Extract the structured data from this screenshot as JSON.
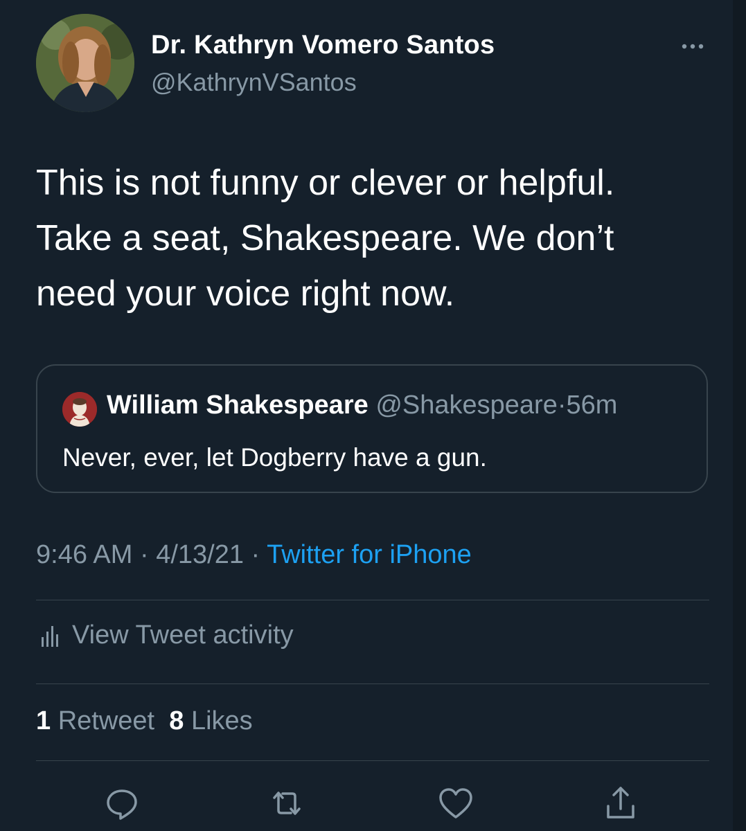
{
  "author": {
    "display_name": "Dr. Kathryn Vomero Santos",
    "handle": "@KathrynVSantos"
  },
  "tweet": {
    "lines": [
      "This is not funny or clever or helpful.",
      "Take a seat, Shakespeare. We don’t",
      "need your voice right now."
    ],
    "time": "9:46 AM",
    "date": "4/13/21",
    "source": "Twitter for iPhone",
    "separator": " · "
  },
  "quoted_tweet": {
    "name": "William Shakespeare",
    "handle": "@Shakespeare",
    "age": "56m",
    "dot": "·",
    "text": "Never, ever, let Dogberry have a gun."
  },
  "activity": {
    "label": "View Tweet activity"
  },
  "stats": {
    "retweet_count": "1",
    "retweet_label": "Retweet",
    "like_count": "8",
    "like_label": "Likes"
  },
  "icons": {
    "more": "more-icon",
    "activity": "bar-chart-icon",
    "reply": "reply-icon",
    "retweet": "retweet-icon",
    "like": "heart-icon",
    "share": "share-icon"
  },
  "colors": {
    "background": "#15202b",
    "secondary_text": "#8899a6",
    "link": "#1da1f2",
    "border": "#38444d"
  }
}
